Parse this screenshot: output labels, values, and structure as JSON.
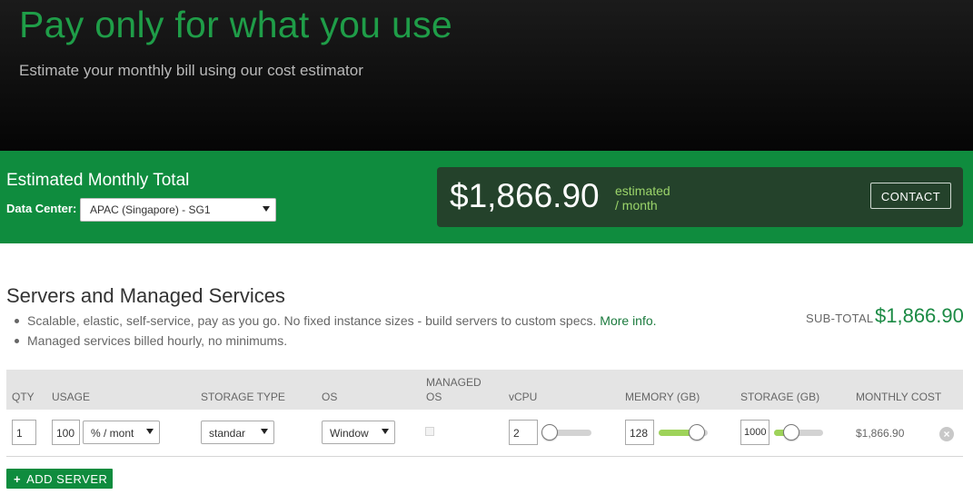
{
  "hero": {
    "title": "Pay only for what you use",
    "subtitle": "Estimate your monthly bill using our cost estimator"
  },
  "summary": {
    "label": "Estimated Monthly Total",
    "data_center_label": "Data Center:",
    "data_center_value": "APAC (Singapore) - SG1",
    "amount": "$1,866.90",
    "estimated_line1": "estimated",
    "estimated_line2": "/ month",
    "contact_label": "CONTACT"
  },
  "section": {
    "title": "Servers and Managed Services",
    "bullet1_text": "Scalable, elastic, self-service, pay as you go. No fixed instance sizes - build servers to custom specs.",
    "bullet1_link": "More info.",
    "bullet2_text": "Managed services billed hourly, no minimums.",
    "subtotal_label": "SUB-TOTAL",
    "subtotal_value": "$1,866.90"
  },
  "table": {
    "headers": {
      "qty": "QTY",
      "usage": "USAGE",
      "storage_type": "STORAGE TYPE",
      "os": "OS",
      "managed_os_1": "MANAGED",
      "managed_os_2": "OS",
      "vcpu": "vCPU",
      "memory": "MEMORY (GB)",
      "storage": "STORAGE (GB)",
      "monthly_cost": "MONTHLY COST"
    },
    "row": {
      "qty": "1",
      "usage": "100",
      "usage_unit": "% / mont",
      "storage_type": "standar",
      "os": "Window",
      "managed_os_checked": false,
      "vcpu": "2",
      "vcpu_level": 0.05,
      "memory": "128",
      "memory_level": 0.85,
      "storage": "1000",
      "storage_level": 0.3,
      "monthly_cost": "$1,866.90"
    }
  },
  "add_server_label": "ADD SERVER",
  "colors": {
    "brand_green": "#0f8c3e",
    "hero_title": "#1f9d48",
    "total_box": "#24422b",
    "slider_fill": "#9ed35a"
  },
  "icons": {
    "remove": "remove-circle-icon",
    "add": "plus-icon",
    "dropdown": "caret-down-icon"
  }
}
